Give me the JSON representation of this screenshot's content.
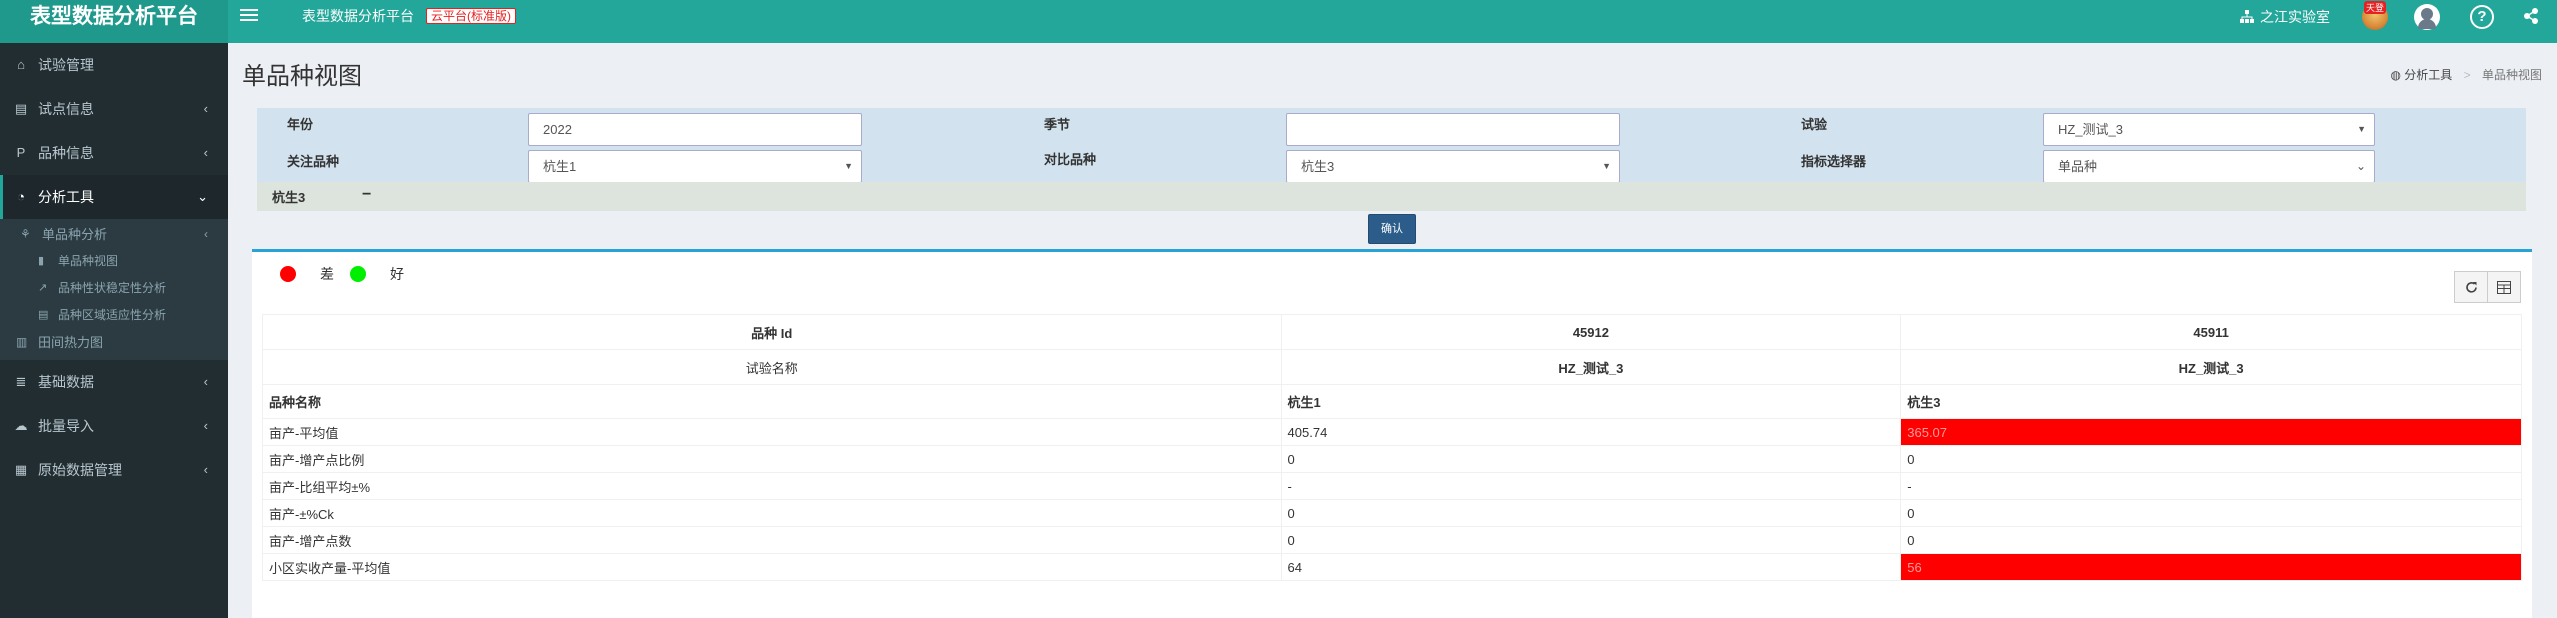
{
  "header": {
    "logo": "表型数据分析平台",
    "title": "表型数据分析平台",
    "badge": "云平台(标准版)",
    "lab": "之江实验室",
    "avatar_badge": "天登",
    "help": "?"
  },
  "sidebar": {
    "items": [
      {
        "label": "试验管理"
      },
      {
        "label": "试点信息"
      },
      {
        "label": "品种信息"
      },
      {
        "label": "分析工具"
      },
      {
        "label": "田间热力图"
      },
      {
        "label": "基础数据"
      },
      {
        "label": "批量导入"
      },
      {
        "label": "原始数据管理"
      }
    ],
    "sub": {
      "group": "单品种分析",
      "children": [
        "单品种视图",
        "品种性状稳定性分析",
        "品种区域适应性分析"
      ]
    }
  },
  "page": {
    "title": "单品种视图",
    "breadcrumb": [
      "分析工具",
      "单品种视图"
    ]
  },
  "filter": {
    "year_label": "年份",
    "year_value": "2022",
    "season_label": "季节",
    "season_value": "",
    "trial_label": "试验",
    "trial_value": "HZ_测试_3",
    "focus_label": "关注品种",
    "focus_value": "杭生1",
    "compare_label": "对比品种",
    "compare_value": "杭生3",
    "metric_label": "指标选择器",
    "metric_value": "单品种",
    "tag": "杭生3",
    "collapse": "−",
    "confirm": "确认"
  },
  "legend": {
    "bad": "差",
    "good": "好",
    "bad_color": "#ff0000",
    "good_color": "#00ee00"
  },
  "table": {
    "id_label": "品种 Id",
    "ids": [
      "45912",
      "45911"
    ],
    "trial_label": "试验名称",
    "trials": [
      "HZ_测试_3",
      "HZ_测试_3"
    ],
    "name_label": "品种名称",
    "names": [
      "杭生1",
      "杭生3"
    ],
    "rows": [
      {
        "label": "亩产-平均值",
        "v1": "405.74",
        "v2": "365.07",
        "bad2": true
      },
      {
        "label": "亩产-增产点比例",
        "v1": "0",
        "v2": "0",
        "bad2": false
      },
      {
        "label": "亩产-比组平均±%",
        "v1": "-",
        "v2": "-",
        "bad2": false
      },
      {
        "label": "亩产-±%Ck",
        "v1": "0",
        "v2": "0",
        "bad2": false
      },
      {
        "label": "亩产-增产点数",
        "v1": "0",
        "v2": "0",
        "bad2": false
      },
      {
        "label": "小区实收产量-平均值",
        "v1": "64",
        "v2": "56",
        "bad2": true
      }
    ]
  },
  "colors": {
    "header": "#23a79a",
    "sidebar": "#222d32",
    "bad": "#ff0000"
  }
}
